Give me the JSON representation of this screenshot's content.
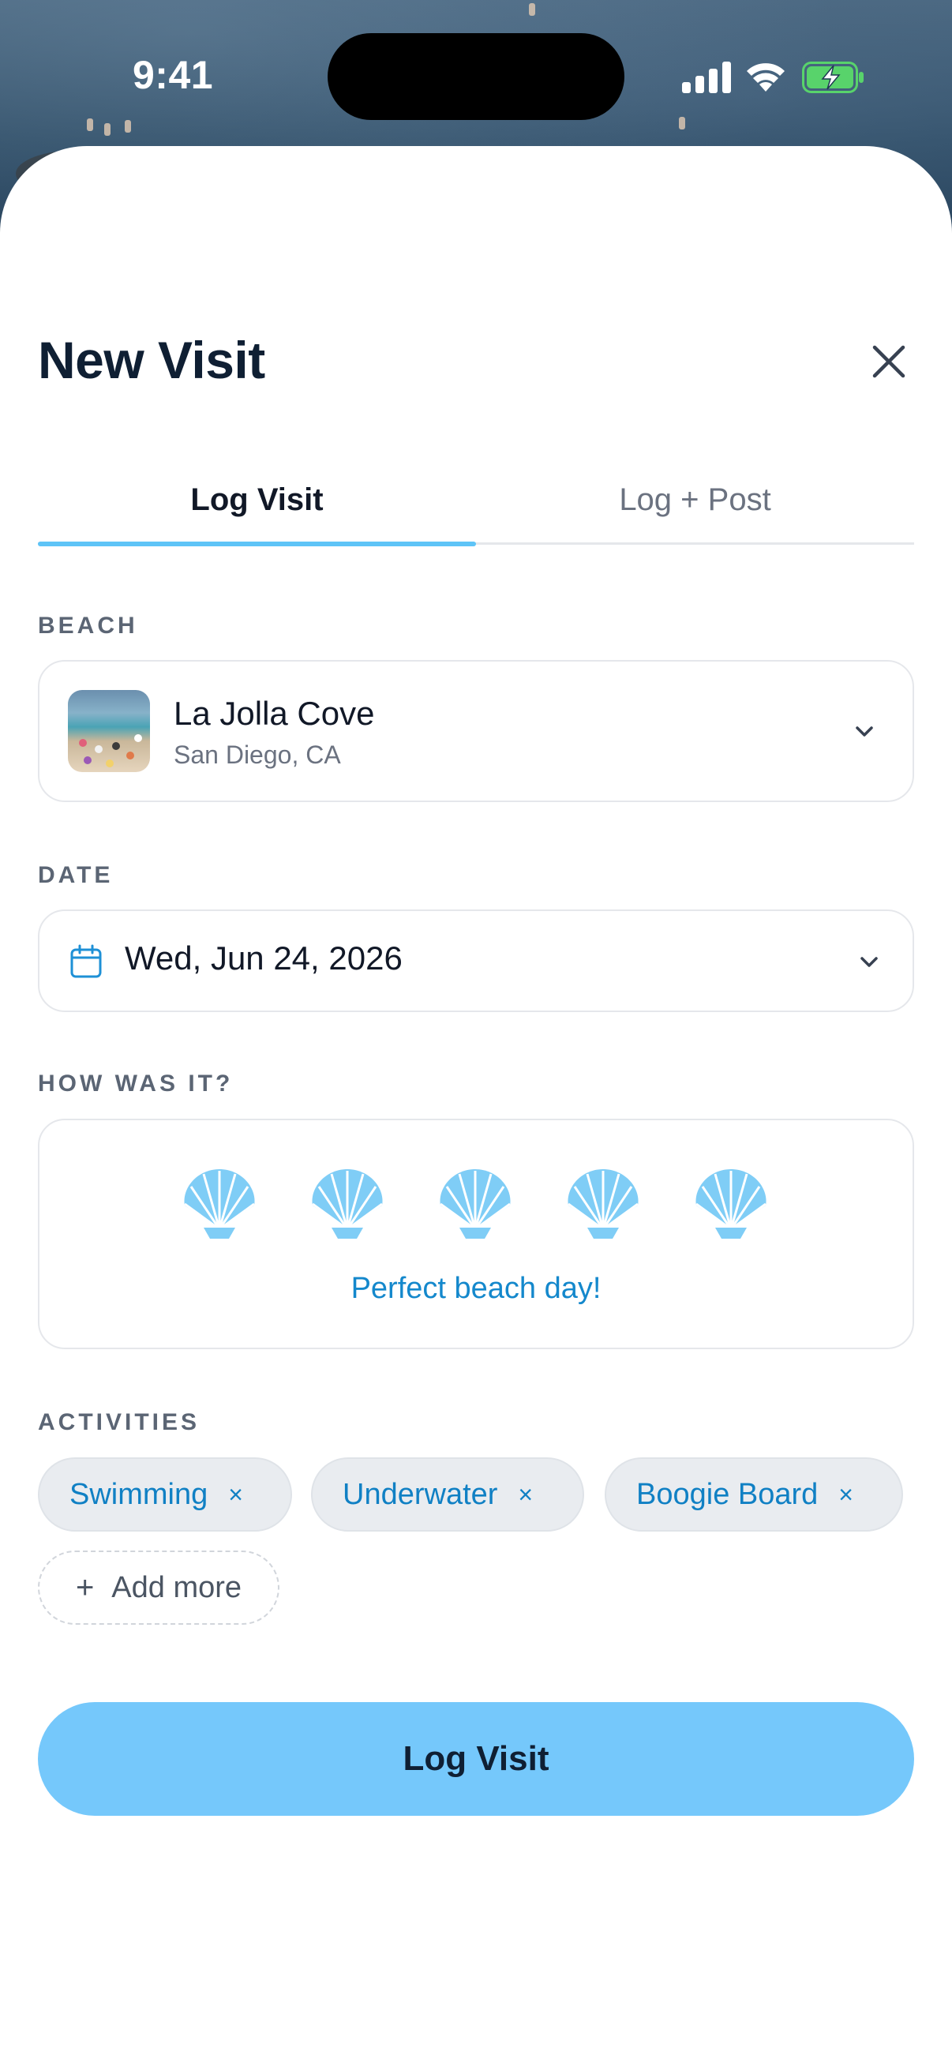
{
  "status_bar": {
    "time": "9:41"
  },
  "sheet": {
    "title": "New Visit",
    "tabs": [
      {
        "label": "Log Visit",
        "active": true
      },
      {
        "label": "Log + Post",
        "active": false
      }
    ],
    "beach": {
      "label": "BEACH",
      "name": "La Jolla Cove",
      "location": "San Diego, CA"
    },
    "date": {
      "label": "DATE",
      "value": "Wed, Jun 24, 2026"
    },
    "rating": {
      "label": "HOW WAS IT?",
      "value": 5,
      "max": 5,
      "caption": "Perfect beach day!",
      "icon": "shell-icon"
    },
    "activities": {
      "label": "ACTIVITIES",
      "chips": [
        "Swimming",
        "Underwater",
        "Boogie Board"
      ],
      "remove_symbol": "×",
      "add_label": "Add more",
      "add_symbol": "+"
    },
    "submit_label": "Log Visit"
  },
  "colors": {
    "accent": "#5ec4f7",
    "button": "#75c8fb",
    "chip_text": "#1080c4",
    "title": "#0f1f33"
  }
}
